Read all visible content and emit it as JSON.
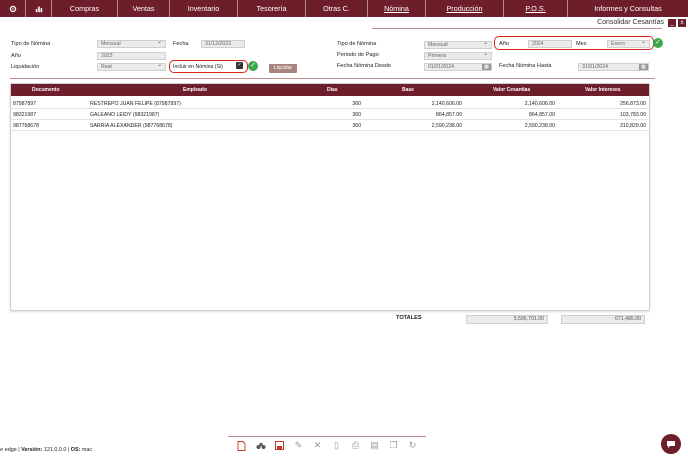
{
  "nav": {
    "items": [
      "Compras",
      "Ventas",
      "Inventario",
      "Tesorería",
      "Otras C.",
      "Nómina",
      "Producción",
      "P.O.S.",
      "Informes y Consultas"
    ],
    "icons": [
      "gear-icon",
      "bar-chart-icon"
    ],
    "accent": "#6e1d2b"
  },
  "window": {
    "title": "Consolidar Cesantías",
    "minimize": "_",
    "close": "x"
  },
  "left_form": {
    "tipo_nomina_label": "Tipo de Nómina",
    "tipo_nomina_value": "Mensual",
    "fecha_label": "Fecha",
    "fecha_value": "31/12/2023",
    "anio_label": "Año",
    "anio_value": "2023",
    "liquidacion_label": "Liquidación",
    "liquidacion_value": "Real",
    "incluir_label": "Incluir en Nómina (Si)",
    "liquidar_button": "Liquidar"
  },
  "right_form": {
    "tipo_nomina_label": "Tipo de Nómina",
    "tipo_nomina_value": "Mensual",
    "anio_label": "Año",
    "anio_value": "2024",
    "mes_label": "Mes",
    "mes_value": "Enero",
    "periodo_label": "Periodo de Pago",
    "periodo_value": "Primera",
    "desde_label": "Fecha Nómina Desde",
    "desde_value": "01/01/2024",
    "hasta_label": "Fecha Nómina Hasta",
    "hasta_value": "31/01/2024"
  },
  "table": {
    "headers": [
      "Documento",
      "Empleado",
      "Dias",
      "Base",
      "Valor Cesantías",
      "Valor Intereses"
    ],
    "rows": [
      [
        "87987897",
        "RESTREPO  JUAN FELIPE (87987897)",
        "360",
        "2,140,606.00",
        "2,140,606.00",
        "256,873.00"
      ],
      [
        "98321987",
        "GALEANO  LEIDY (98321987)",
        "360",
        "864,857.00",
        "864,857.00",
        "103,783.00"
      ],
      [
        "987768678",
        "SARRIA  ALEXANDER (987768678)",
        "360",
        "2,590,238.00",
        "2,590,238.00",
        "310,829.00"
      ]
    ]
  },
  "totals": {
    "label": "TOTALES",
    "cesantias": "5,595,701.00",
    "intereses": "671,485.00"
  },
  "footer": {
    "brand": "edge",
    "version_label": "Versión:",
    "version": "121.0.0.0",
    "os_label": "OS:",
    "os": "mac"
  },
  "toolbar_icons": [
    "new-doc-icon",
    "binoculars-icon",
    "save-icon",
    "edit-icon",
    "delete-icon",
    "text-icon",
    "print-icon",
    "pdf-icon",
    "copy-icon",
    "refresh-icon"
  ]
}
